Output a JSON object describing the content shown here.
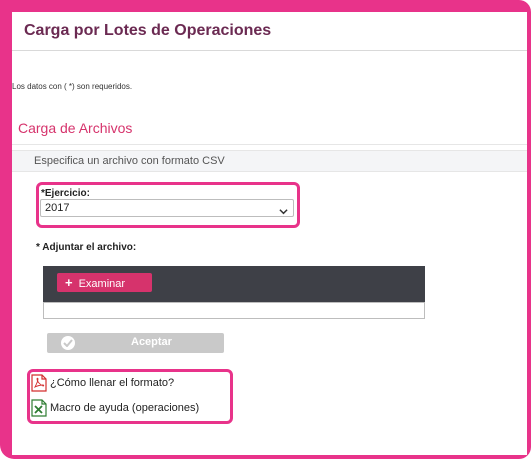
{
  "page": {
    "title": "Carga por Lotes de Operaciones",
    "required_note": "Los datos con ( *) son requeridos."
  },
  "section": {
    "heading": "Carga de Archivos",
    "subtitle": "Especifica un archivo con formato CSV"
  },
  "ejercicio": {
    "label": "*Ejercicio:",
    "value": "2017",
    "icon": "chevron-down-icon"
  },
  "adjuntar": {
    "label": "* Adjuntar el archivo:",
    "browse_label": "Examinar",
    "browse_icon": "plus-icon",
    "file_value": ""
  },
  "accept": {
    "label": "Aceptar",
    "icon": "check-circle-icon"
  },
  "links": [
    {
      "label": "¿Cómo llenar el formato?",
      "icon": "pdf-icon"
    },
    {
      "label": "Macro de ayuda (operaciones)",
      "icon": "excel-icon"
    }
  ],
  "colors": {
    "accent": "#d6336c",
    "highlight": "#e8338a",
    "title": "#6b2a52",
    "upload_bar": "#3e4047",
    "disabled_button": "#c9c9c9"
  }
}
